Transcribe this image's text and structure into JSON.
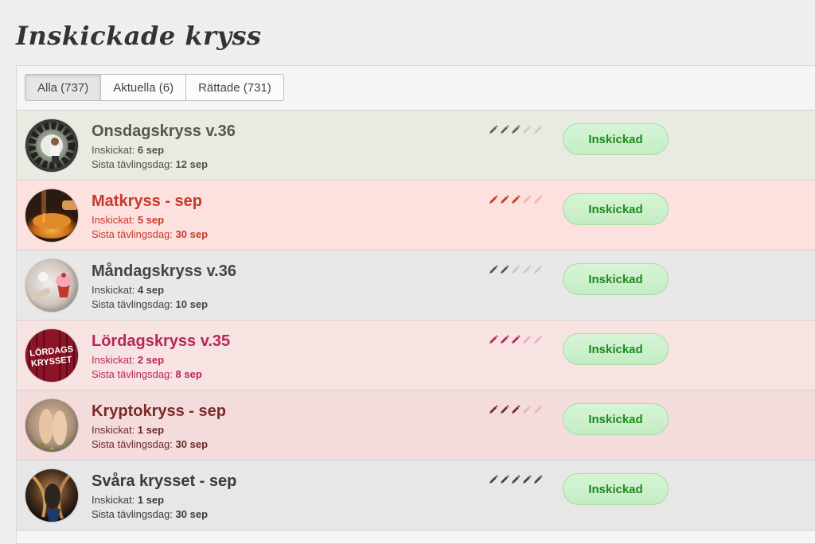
{
  "page": {
    "title": "Inskickade kryss"
  },
  "tabs": [
    {
      "label": "Alla (737)",
      "active": true
    },
    {
      "label": "Aktuella (6)",
      "active": false
    },
    {
      "label": "Rättade (731)",
      "active": false
    }
  ],
  "labels": {
    "submitted": "Inskickat:",
    "last_day": "Sista tävlingsdag:"
  },
  "items": [
    {
      "title": "Onsdagskryss v.36",
      "submitted": "6 sep",
      "last_day": "12 sep",
      "difficulty": 3,
      "status": "Inskickad",
      "colors": {
        "bg": "#e9ebe3",
        "title": "#55574e",
        "text": "#4f5049",
        "pencil": "#5f6158",
        "pencil_off": "#c9cbc4"
      },
      "avatar_icon": "tractor-tire-person-image"
    },
    {
      "title": "Matkryss - sep",
      "submitted": "5 sep",
      "last_day": "30 sep",
      "difficulty": 3,
      "status": "Inskickad",
      "colors": {
        "bg": "#fde1de",
        "title": "#c8382c",
        "text": "#c8382c",
        "pencil": "#c8382c",
        "pencil_off": "#f0b3ad"
      },
      "avatar_icon": "honey-bowl-image"
    },
    {
      "title": "Måndagskryss v.36",
      "submitted": "4 sep",
      "last_day": "10 sep",
      "difficulty": 2,
      "status": "Inskickad",
      "colors": {
        "bg": "#e8e8e8",
        "title": "#444444",
        "text": "#444444",
        "pencil": "#555555",
        "pencil_off": "#c8c8c8"
      },
      "avatar_icon": "cupcake-baking-image"
    },
    {
      "title": "Lördagskryss v.35",
      "submitted": "2 sep",
      "last_day": "8 sep",
      "difficulty": 3,
      "status": "Inskickad",
      "colors": {
        "bg": "#f8e3e3",
        "title": "#b8265a",
        "text": "#b8265a",
        "pencil": "#b8265a",
        "pencil_off": "#e9b0c2"
      },
      "avatar_icon": "lordagskrysset-logo",
      "avatar_text": [
        "LÖRDAGS",
        "KRYSSET"
      ]
    },
    {
      "title": "Kryptokryss - sep",
      "submitted": "1 sep",
      "last_day": "30 sep",
      "difficulty": 3,
      "status": "Inskickad",
      "colors": {
        "bg": "#f5dcdc",
        "title": "#7a2a2a",
        "text": "#6a2a2a",
        "pencil": "#7a2a2a",
        "pencil_off": "#e3b9b9"
      },
      "avatar_icon": "feet-image"
    },
    {
      "title": "Svåra krysset - sep",
      "submitted": "1 sep",
      "last_day": "30 sep",
      "difficulty": 5,
      "status": "Inskickad",
      "colors": {
        "bg": "#e7e7e7",
        "title": "#3a3a3a",
        "text": "#3a3a3a",
        "pencil": "#444444",
        "pencil_off": "#c6c6c6"
      },
      "avatar_icon": "rope-figure-image"
    }
  ]
}
